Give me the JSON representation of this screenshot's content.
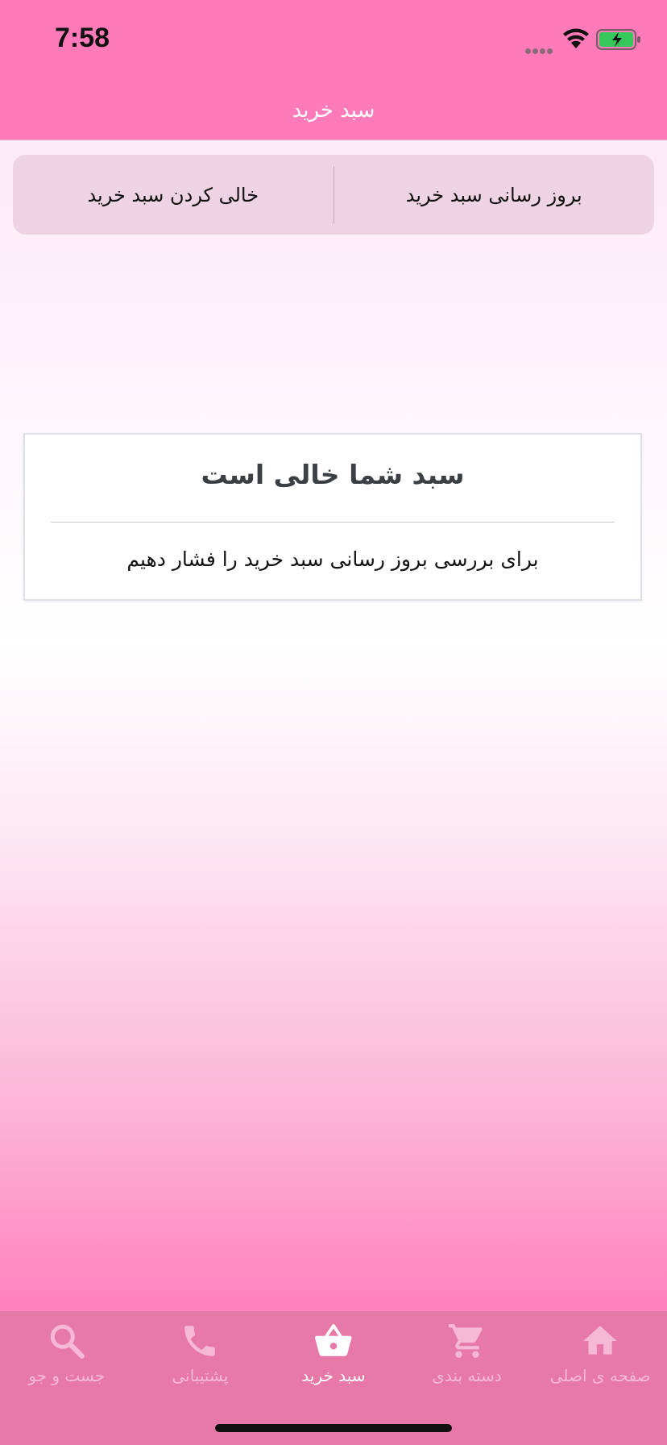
{
  "status_bar": {
    "time": "7:58"
  },
  "nav": {
    "title": "سبد خرید"
  },
  "actions": {
    "refresh_label": "بروز رسانی سبد خرید",
    "clear_label": "خالی کردن سبد خرید"
  },
  "empty_state": {
    "title": "سبد شما خالی است",
    "message": "برای بررسی بروز رسانی سبد خرید را فشار دهیم"
  },
  "tabs": [
    {
      "label": "جست و جو",
      "icon": "search-icon",
      "active": false
    },
    {
      "label": "پشتیبانی",
      "icon": "phone-icon",
      "active": false
    },
    {
      "label": "سبد خرید",
      "icon": "basket-icon",
      "active": true
    },
    {
      "label": "دسته بندی",
      "icon": "cart-icon",
      "active": false
    },
    {
      "label": "صفحه ی اصلی",
      "icon": "home-icon",
      "active": false
    }
  ],
  "colors": {
    "header": "#ff7ab9",
    "tab_bar": "#e779a8",
    "tab_inactive": "#f6b9d5",
    "tab_active": "#ffffff"
  }
}
